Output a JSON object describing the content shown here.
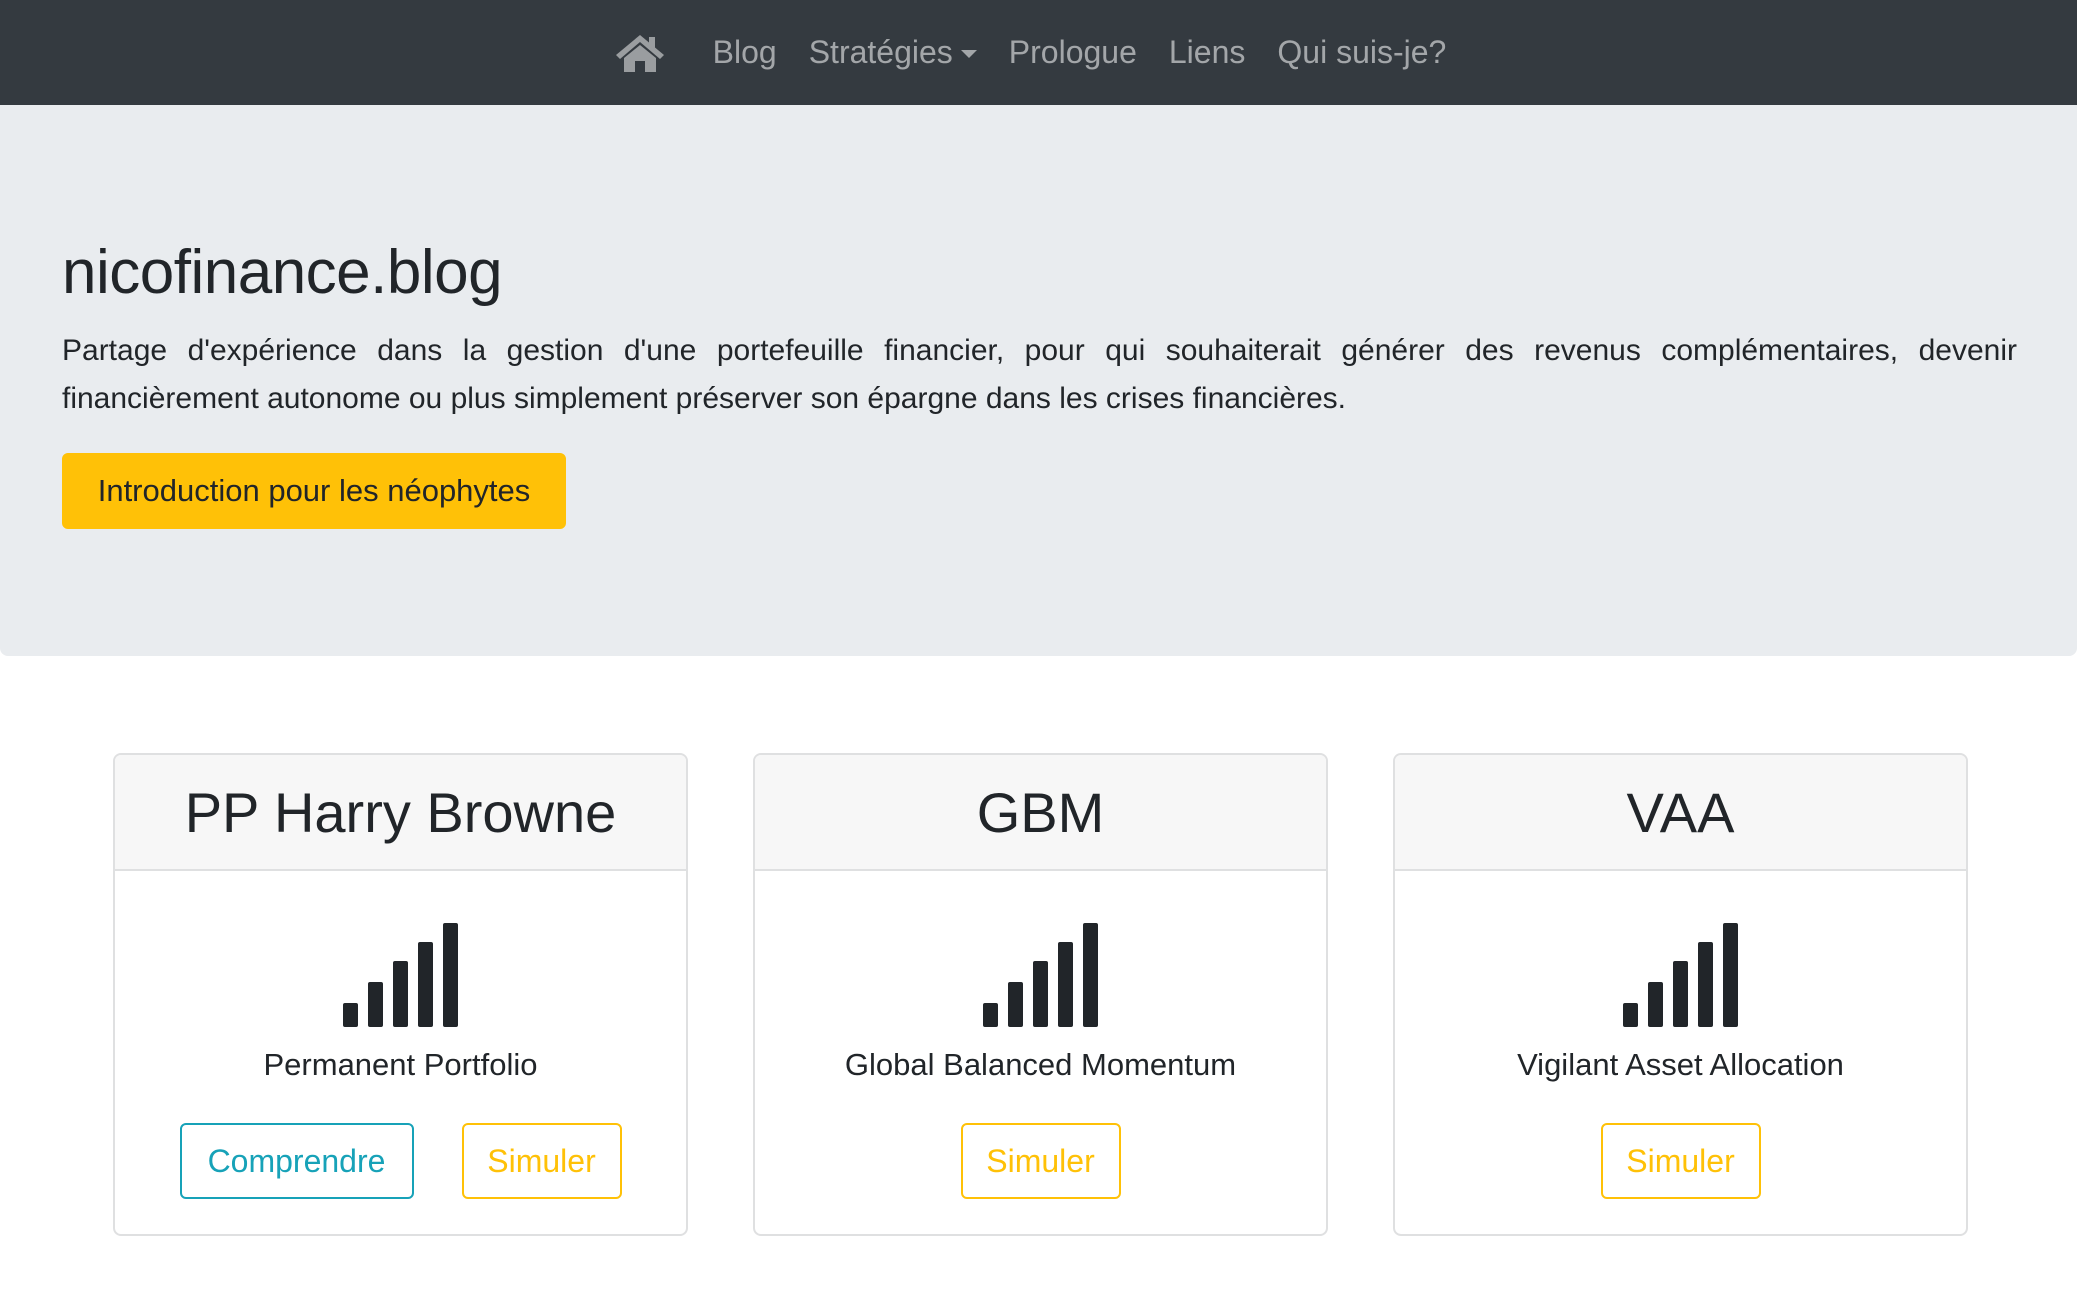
{
  "navbar": {
    "home_icon": "home-icon",
    "items": [
      {
        "label": "Blog"
      },
      {
        "label": "Stratégies",
        "dropdown": true
      },
      {
        "label": "Prologue"
      },
      {
        "label": "Liens"
      },
      {
        "label": "Qui suis-je?"
      }
    ]
  },
  "hero": {
    "title": "nicofinance.blog",
    "lead": "Partage d'expérience dans la gestion d'une portefeuille financier, pour qui souhaiterait générer des revenus complémentaires, devenir financièrement autonome ou plus simplement préserver son épargne dans les crises financières.",
    "button_label": "Introduction pour les néophytes"
  },
  "cards": [
    {
      "title": "PP Harry Browne",
      "icon": "signal-bars-icon",
      "subtitle": "Permanent Portfolio",
      "buttons": [
        {
          "label": "Comprendre",
          "style": "info"
        },
        {
          "label": "Simuler",
          "style": "warning"
        }
      ]
    },
    {
      "title": "GBM",
      "icon": "signal-bars-icon",
      "subtitle": "Global Balanced Momentum",
      "buttons": [
        {
          "label": "Simuler",
          "style": "warning"
        }
      ]
    },
    {
      "title": "VAA",
      "icon": "signal-bars-icon",
      "subtitle": "Vigilant Asset Allocation",
      "buttons": [
        {
          "label": "Simuler",
          "style": "warning"
        }
      ]
    }
  ],
  "colors": {
    "navbar_bg": "#343a40",
    "nav_link": "#9a9da0",
    "jumbotron_bg": "#e9ecef",
    "warning": "#ffc107",
    "info": "#17a2b8",
    "text": "#212529"
  }
}
